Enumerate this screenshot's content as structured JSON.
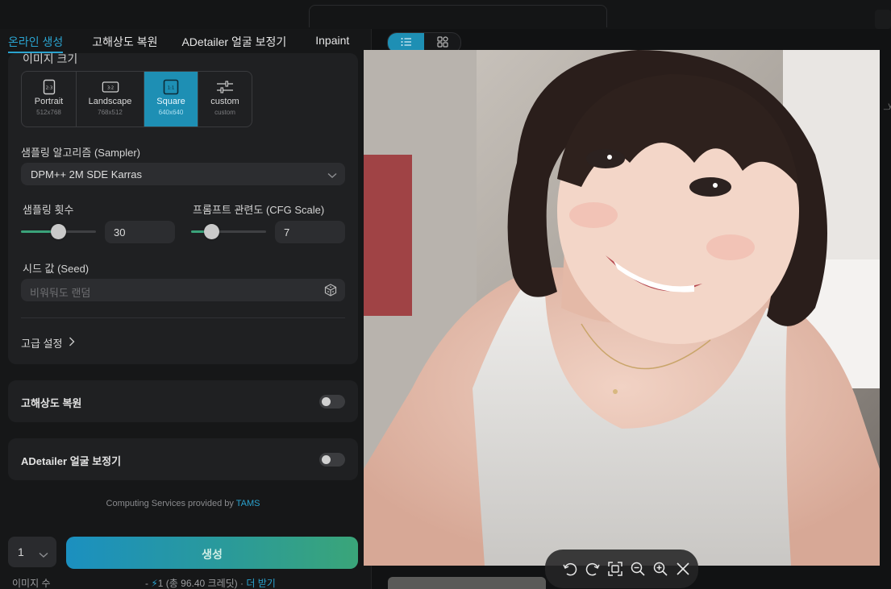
{
  "tabs": [
    {
      "label": "온라인 생성",
      "active": true
    },
    {
      "label": "고해상도 복원",
      "active": false
    },
    {
      "label": "ADetailer 얼굴 보정기",
      "active": false
    },
    {
      "label": "Inpaint",
      "active": false
    }
  ],
  "settings": {
    "image_size_label": "이미지 크기",
    "sizes": [
      {
        "icon": "portrait-frame-icon",
        "ratio": "2:3",
        "name": "Portrait",
        "dims": "512x768",
        "selected": false
      },
      {
        "icon": "landscape-frame-icon",
        "ratio": "3:2",
        "name": "Landscape",
        "dims": "768x512",
        "selected": false
      },
      {
        "icon": "square-frame-icon",
        "ratio": "1:1",
        "name": "Square",
        "dims": "640x640",
        "selected": true
      },
      {
        "icon": "sliders-icon",
        "ratio": "",
        "name": "custom",
        "dims": "custom",
        "selected": false
      }
    ],
    "sampler_label": "샘플링 알고리즘 (Sampler)",
    "sampler_value": "DPM++ 2M SDE Karras",
    "steps_label": "샘플링 횟수",
    "steps_value": "30",
    "steps_fraction": 0.49,
    "cfg_label": "프롬프트 관련도 (CFG Scale)",
    "cfg_value": "7",
    "cfg_fraction": 0.27,
    "seed_label": "시드 값 (Seed)",
    "seed_placeholder": "비워둬도 랜덤",
    "advanced_label": "고급 설정"
  },
  "hires": {
    "label": "고해상도 복원",
    "enabled": false
  },
  "adetailer": {
    "label": "ADetailer 얼굴 보정기",
    "enabled": false
  },
  "footer": {
    "provided_prefix": "Computing Services provided by ",
    "provided_link": "TAMS",
    "count_value": "1",
    "count_label": "이미지 수",
    "generate_label": "생성",
    "credits_prefix": "- ",
    "credits_amount": "1",
    "credits_total": " (총 96.40 크레딧) · ",
    "credits_more": "더 받기"
  },
  "colors": {
    "accent": "#2aa3cf",
    "generate_start": "#1b90c0",
    "generate_end": "#3aa579"
  },
  "right_edge_text": "_yu"
}
